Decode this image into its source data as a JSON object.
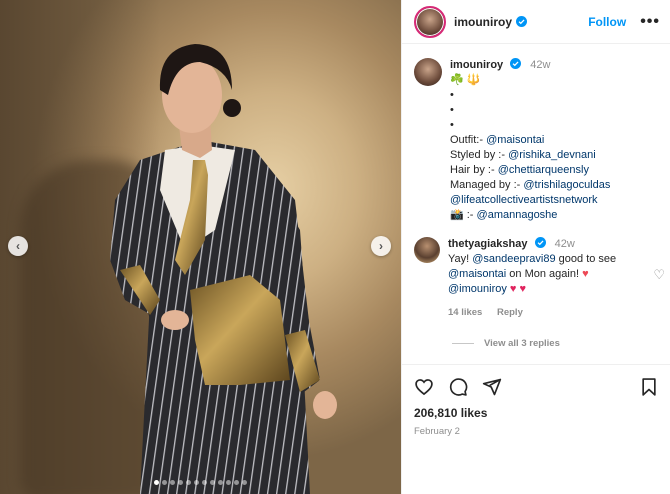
{
  "post": {
    "author": "imouniroy",
    "follow_label": "Follow",
    "more_label": "•••",
    "total_slides": 12,
    "active_slide": 1
  },
  "caption": {
    "author": "imouniroy",
    "time": "42w",
    "emoji_line": "☘️ 🔱",
    "bullets": [
      "•",
      "•",
      "•"
    ],
    "outfit_label": "Outfit:- ",
    "outfit_mention": "@maisontai",
    "styled_label": "Styled by :- ",
    "styled_mention": "@rishika_devnani",
    "hair_label": "Hair by :- ",
    "hair_mention": "@chettiarqueensly",
    "managed_label": "Managed by :- ",
    "managed_mention": "@trishilagoculdas",
    "network_mention": "@lifeatcollectiveartistsnetwork",
    "camera_prefix": "📸 :- ",
    "camera_mention": "@amannagoshe"
  },
  "comment": {
    "author": "thetyagiakshay",
    "time": "42w",
    "text_1": "Yay! ",
    "mention_1": "@sandeepravi89",
    "text_2": " good to see ",
    "mention_2": "@maisontai",
    "text_3": " on Mon again! ",
    "mention_3": "@imouniroy",
    "likes": "14 likes",
    "reply_label": "Reply",
    "view_replies": "View all 3 replies"
  },
  "footer": {
    "likes": "206,810 likes",
    "date": "February 2"
  },
  "colors": {
    "link_blue": "#0095f6",
    "mention_blue": "#00376b",
    "muted": "#8e8e8e",
    "text": "#262626"
  },
  "icons": [
    "more-icon",
    "verified-icon",
    "heart-icon",
    "comment-icon",
    "share-icon",
    "save-icon",
    "chevron-left-icon",
    "chevron-right-icon"
  ]
}
